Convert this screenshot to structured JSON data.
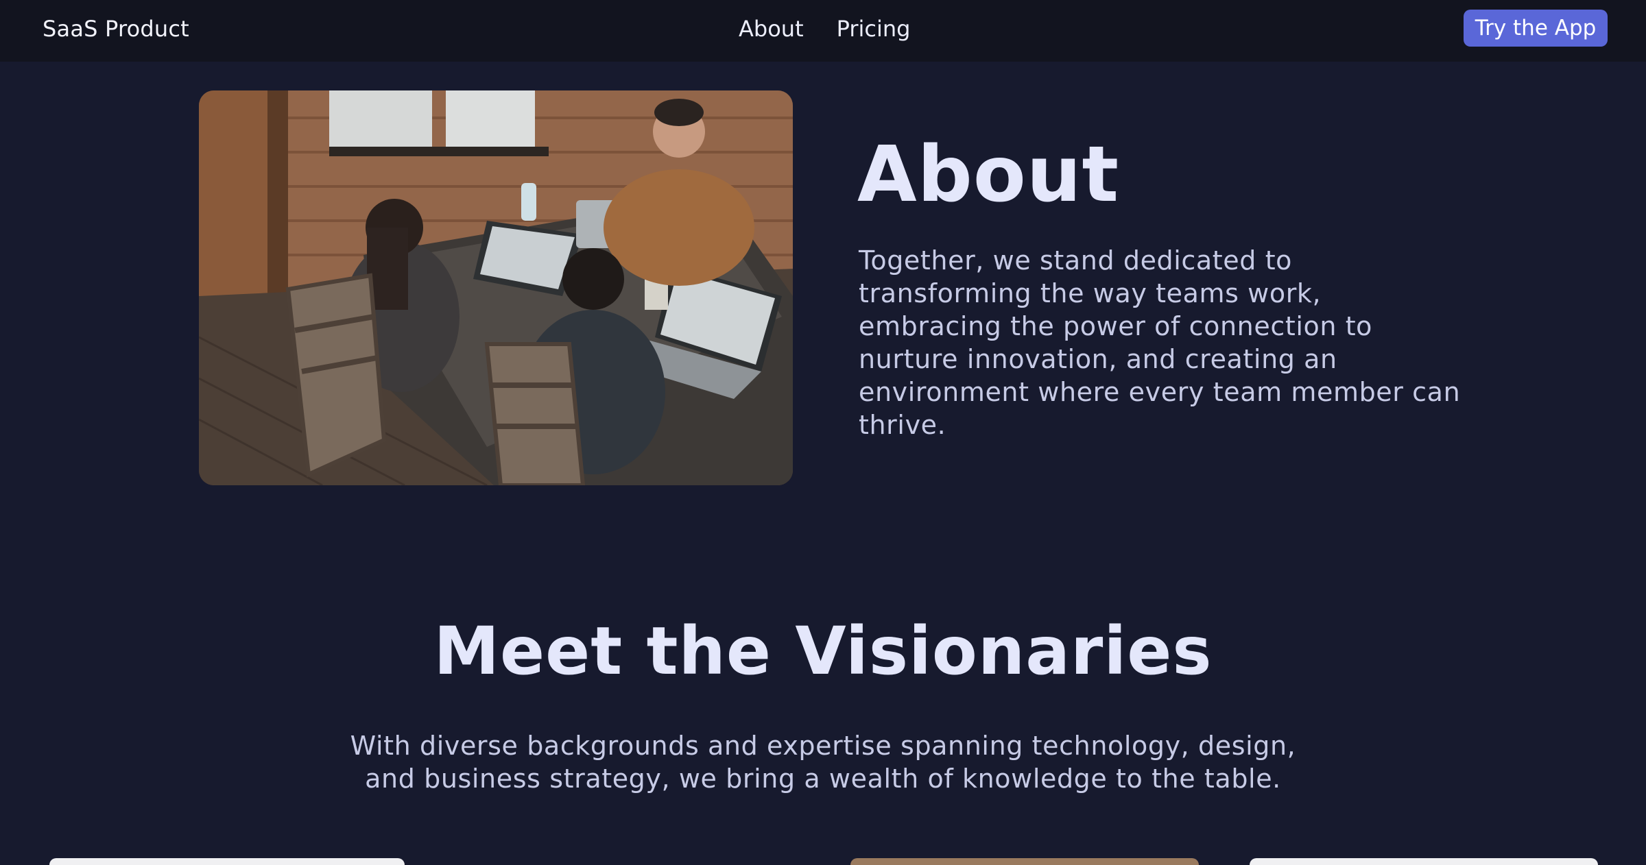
{
  "navbar": {
    "brand": "SaaS Product",
    "links": [
      {
        "label": "About"
      },
      {
        "label": "Pricing"
      }
    ],
    "cta_label": "Try the App",
    "cta_color": "#5a67d8"
  },
  "about": {
    "title": "About",
    "body": "Together, we stand dedicated to transforming the way teams work, embracing the power of connection to nurture innovation, and creating an environment where every team member can thrive."
  },
  "team": {
    "title": "Meet the Visionaries",
    "body_line1": "With diverse backgrounds and expertise spanning technology, design,",
    "body_line2": "and business strategy, we bring a wealth of knowledge to the table."
  },
  "colors": {
    "page_background": "#171a2e",
    "navbar_background": "#12141f",
    "heading": "#e4e7fb",
    "body_text": "#c7cbe6"
  }
}
